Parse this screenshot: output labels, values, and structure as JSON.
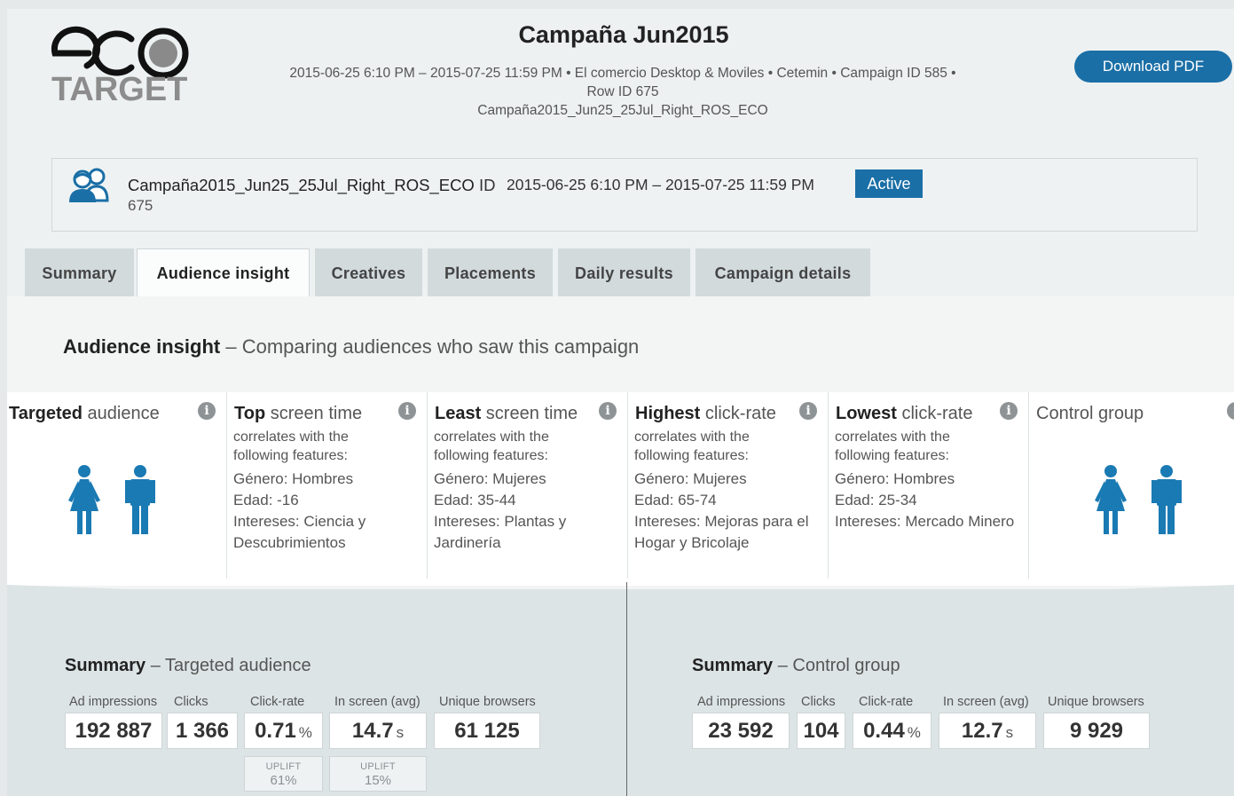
{
  "header": {
    "logo_top": "eco",
    "logo_bottom": "TARGET",
    "title": "Campaña Jun2015",
    "subtitle_line1": "2015-06-25 6:10 PM – 2015-07-25 11:59 PM • El comercio Desktop & Moviles • Cetemin • Campaign ID 585 •",
    "subtitle_line2": "Row ID 675",
    "subtitle_line3": "Campaña2015_Jun25_25Jul_Right_ROS_ECO",
    "download_label": "Download PDF"
  },
  "campaign": {
    "name": "Campaña2015_Jun25_25Jul_Right_ROS_ECO",
    "id_label": " ID",
    "id_value": "675",
    "dates": "2015-06-25 6:10 PM – 2015-07-25 11:59 PM",
    "status": "Active"
  },
  "tabs": [
    {
      "label": "Summary",
      "active": false
    },
    {
      "label": "Audience insight",
      "active": true
    },
    {
      "label": "Creatives",
      "active": false
    },
    {
      "label": "Placements",
      "active": false
    },
    {
      "label": "Daily results",
      "active": false
    },
    {
      "label": "Campaign details",
      "active": false
    }
  ],
  "section": {
    "title_bold": "Audience insight",
    "title_rest": " – Comparing audiences who saw this campaign"
  },
  "audiences": [
    {
      "bold": "Targeted",
      "rest": " audience",
      "desc": "",
      "features": []
    },
    {
      "bold": "Top",
      "rest": " screen time",
      "desc": "correlates with the following features:",
      "features": [
        "Género: Hombres",
        "Edad: -16",
        "Intereses: Ciencia y Descubrimientos"
      ]
    },
    {
      "bold": "Least",
      "rest": " screen time",
      "desc": "correlates with the following features:",
      "features": [
        "Género: Mujeres",
        "Edad: 35-44",
        "Intereses: Plantas y Jardinería"
      ]
    },
    {
      "bold": "Highest",
      "rest": " click-rate",
      "desc": "correlates with the following features:",
      "features": [
        "Género: Mujeres",
        "Edad: 65-74",
        "Intereses: Mejoras para el Hogar y Bricolaje"
      ]
    },
    {
      "bold": "Lowest",
      "rest": " click-rate",
      "desc": "correlates with the following features:",
      "features": [
        "Género: Hombres",
        "Edad: 25-34",
        "Intereses: Mercado Minero"
      ]
    },
    {
      "bold": "",
      "rest": "Control group",
      "desc": "",
      "features": []
    }
  ],
  "summary_targeted": {
    "title_bold": "Summary",
    "title_rest": " – Targeted audience",
    "labels": [
      "Ad impressions",
      "Clicks",
      "Click-rate",
      "In screen (avg)",
      "Unique browsers"
    ],
    "values": [
      "192 887",
      "1 366",
      "0.71",
      "14.7",
      "61 125"
    ],
    "units": [
      "",
      "",
      "%",
      "s",
      ""
    ],
    "uplift_label": "UPLIFT",
    "uplifts": [
      "61%",
      "15%"
    ]
  },
  "summary_control": {
    "title_bold": "Summary",
    "title_rest": " – Control group",
    "labels": [
      "Ad impressions",
      "Clicks",
      "Click-rate",
      "In screen (avg)",
      "Unique browsers"
    ],
    "values": [
      "23 592",
      "104",
      "0.44",
      "12.7",
      "9 929"
    ],
    "units": [
      "",
      "",
      "%",
      "s",
      ""
    ]
  },
  "icons": {
    "info": "info-icon",
    "people": "users-icon",
    "female": "female-figure-icon",
    "male": "male-figure-icon"
  },
  "colors": {
    "brand_blue": "#1a6fa6",
    "figure_blue": "#1a7ab3"
  }
}
